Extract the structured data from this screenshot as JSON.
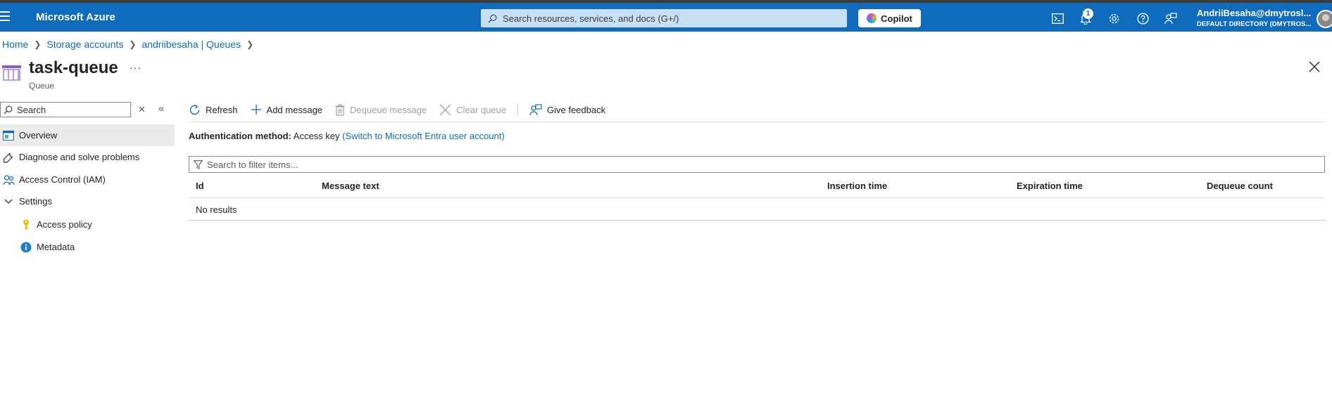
{
  "header": {
    "brand": "Microsoft Azure",
    "search_placeholder": "Search resources, services, and docs (G+/)",
    "copilot_label": "Copilot",
    "notification_count": "1",
    "user_name": "AndriiBesaha@dmytrosl...",
    "user_directory": "DEFAULT DIRECTORY (DMYTROS...",
    "accent": "#0f6cbd"
  },
  "breadcrumb": [
    "Home",
    "Storage accounts",
    "andriibesaha | Queues"
  ],
  "page": {
    "title": "task-queue",
    "subtitle": "Queue",
    "more": "···"
  },
  "sidebar": {
    "search_placeholder": "Search",
    "items": [
      {
        "label": "Overview",
        "icon": "overview-icon",
        "active": true
      },
      {
        "label": "Diagnose and solve problems",
        "icon": "wrench-icon"
      },
      {
        "label": "Access Control (IAM)",
        "icon": "people-icon"
      },
      {
        "label": "Settings",
        "icon": "chevron-down-icon"
      },
      {
        "label": "Access policy",
        "icon": "key-icon"
      },
      {
        "label": "Metadata",
        "icon": "info-icon"
      }
    ]
  },
  "toolbar": {
    "refresh": "Refresh",
    "add_message": "Add message",
    "dequeue_message": "Dequeue message",
    "clear_queue": "Clear queue",
    "give_feedback": "Give feedback"
  },
  "auth": {
    "label": "Authentication method:",
    "value": "Access key",
    "switch_link": "(Switch to Microsoft Entra user account)"
  },
  "grid": {
    "filter_placeholder": "Search to filter items...",
    "columns": [
      "Id",
      "Message text",
      "Insertion time",
      "Expiration time",
      "Dequeue count"
    ],
    "empty_text": "No results"
  }
}
